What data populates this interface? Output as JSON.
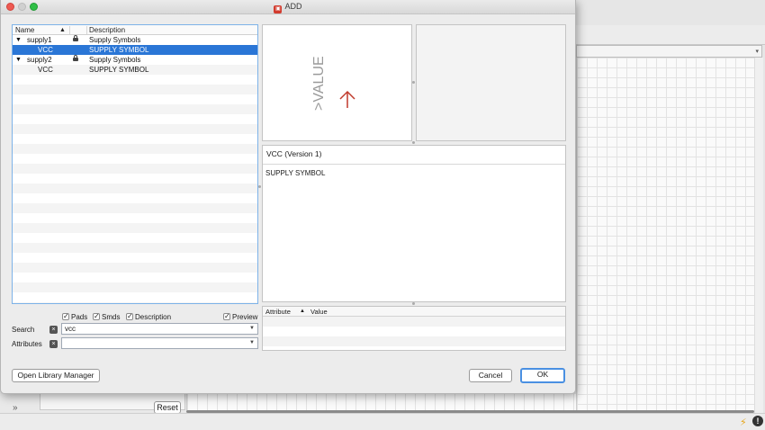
{
  "window": {
    "title": "ADD"
  },
  "tree": {
    "columns": {
      "name": "Name",
      "description": "Description"
    },
    "rows": [
      {
        "kind": "library",
        "name": "supply1",
        "description": "Supply Symbols",
        "locked": true,
        "selected": false
      },
      {
        "kind": "device",
        "name": "VCC",
        "description": "SUPPLY SYMBOL",
        "locked": false,
        "selected": true
      },
      {
        "kind": "library",
        "name": "supply2",
        "description": "Supply Symbols",
        "locked": true,
        "selected": false
      },
      {
        "kind": "device",
        "name": "VCC",
        "description": "SUPPLY SYMBOL",
        "locked": false,
        "selected": false
      }
    ]
  },
  "filters": {
    "pads": "Pads",
    "smds": "Smds",
    "description": "Description",
    "preview": "Preview"
  },
  "search": {
    "label": "Search",
    "value": "vcc"
  },
  "attributes": {
    "label": "Attributes",
    "value": ""
  },
  "preview": {
    "symbol_text": ">VALUE",
    "symbol_color": "#c0392b"
  },
  "details": {
    "title": "VCC (Version 1)",
    "body": "SUPPLY SYMBOL"
  },
  "attribute_table": {
    "col_attribute": "Attribute",
    "col_value": "Value"
  },
  "buttons": {
    "open_library_manager": "Open Library Manager",
    "cancel": "Cancel",
    "ok": "OK"
  },
  "background": {
    "reset": "Reset"
  }
}
